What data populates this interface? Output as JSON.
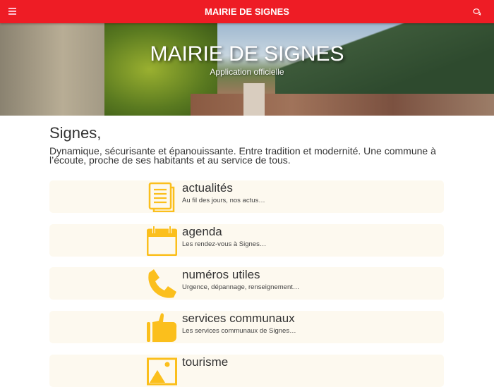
{
  "header": {
    "title": "MAIRIE DE SIGNES"
  },
  "hero": {
    "title": "MAIRIE DE SIGNES",
    "subtitle": "Application officielle"
  },
  "intro": {
    "heading": "Signes,",
    "text": "Dynamique, sécurisante et épanouissante. Entre tradition et modernité. Une commune à l’écoute, proche de ses habitants et au service de tous."
  },
  "accent": "#fbbf1c",
  "brand": "#ee1c25",
  "menu": [
    {
      "icon": "document-icon",
      "title": "actualités",
      "desc": "Au fil des jours, nos actus…"
    },
    {
      "icon": "calendar-icon",
      "title": "agenda",
      "desc": "Les rendez-vous à Signes…"
    },
    {
      "icon": "phone-icon",
      "title": "numéros utiles",
      "desc": "Urgence, dépannage, renseignement…"
    },
    {
      "icon": "thumbs-up-icon",
      "title": "services communaux",
      "desc": "Les services communaux de Signes…"
    },
    {
      "icon": "image-icon",
      "title": "tourisme",
      "desc": ""
    }
  ]
}
